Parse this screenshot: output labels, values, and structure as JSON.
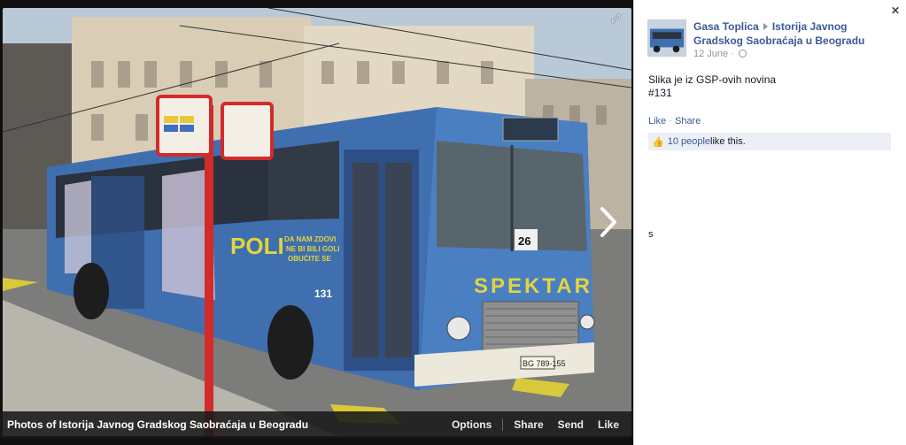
{
  "viewer": {
    "caption_title": "Photos of Istorija Javnog Gradskog Saobraćaja u Beogradu",
    "actions": [
      "Options",
      "Share",
      "Send",
      "Like"
    ],
    "photo_texts": {
      "bus_headsign_brand": "SPEKTAR",
      "bus_side_ad": "POLI",
      "bus_side_slogan_1": "DA NAM ZDOVI",
      "bus_side_slogan_2": "NE BI BILI GOLI",
      "bus_side_slogan_3": "OBUĆITE SE",
      "bus_number": "131",
      "route_number": "26",
      "plate": "BG 789-155"
    }
  },
  "panel": {
    "author": "Gasa Toplica",
    "page": "Istorija Javnog Gradskog Saobraćaja u Beogradu",
    "date": "12 June",
    "text_line1": "Slika je iz GSP-ovih novina",
    "text_line2": "#131",
    "like_label": "Like",
    "share_label": "Share",
    "likes_count": "10 people",
    "likes_suffix": " like this.",
    "stray_char": "s"
  },
  "colors": {
    "link": "#3b5998",
    "bus_blue": "#3f6fae",
    "pole_red": "#d32a2a"
  }
}
